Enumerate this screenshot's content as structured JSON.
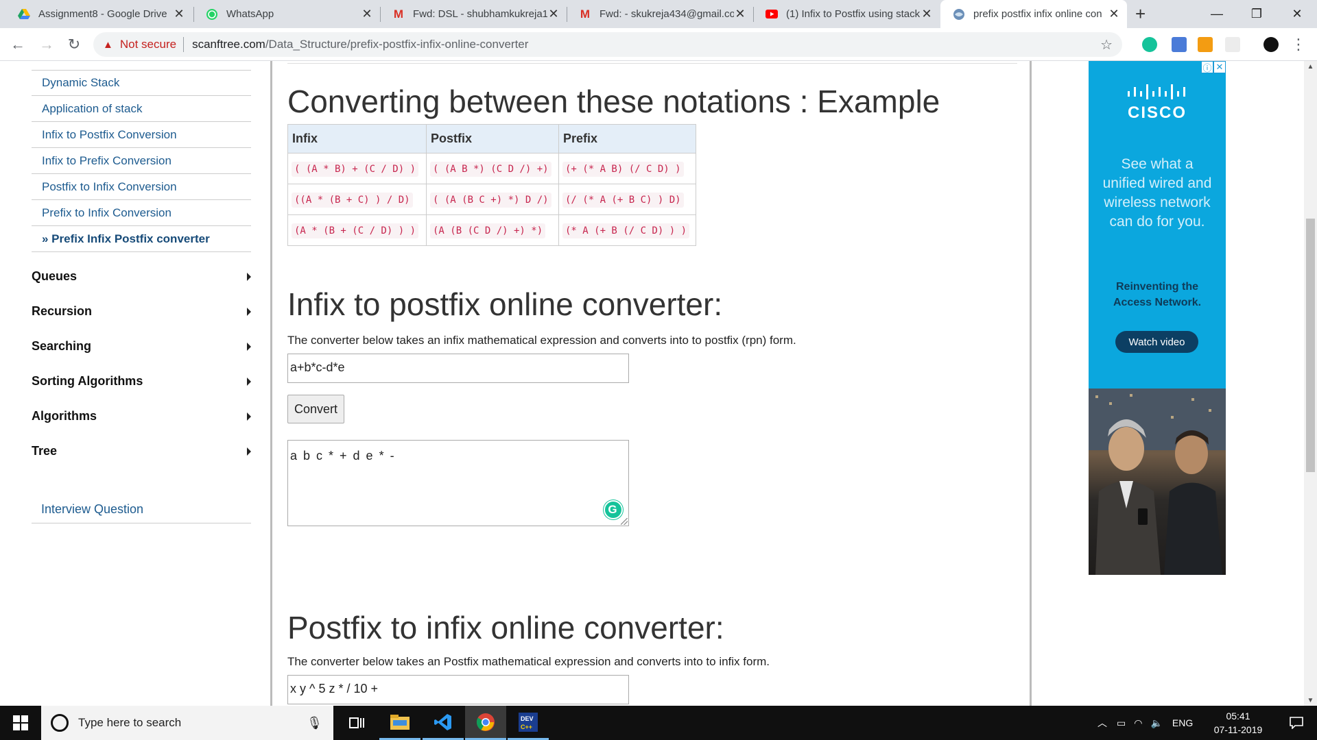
{
  "browser": {
    "tabs": [
      {
        "title": "Assignment8 - Google Drive",
        "icon": "google-drive-icon"
      },
      {
        "title": "WhatsApp",
        "icon": "whatsapp-icon"
      },
      {
        "title": "Fwd: DSL - shubhamkukreja1",
        "icon": "gmail-icon"
      },
      {
        "title": "Fwd: - skukreja434@gmail.co",
        "icon": "gmail-icon"
      },
      {
        "title": "(1) Infix to Postfix using stack",
        "icon": "youtube-icon"
      },
      {
        "title": "prefix postfix infix online con",
        "icon": "site-icon"
      }
    ],
    "security_label": "Not secure",
    "url_host": "scanftree.com",
    "url_path": "/Data_Structure/prefix-postfix-infix-online-converter"
  },
  "sidebar": {
    "sub_items": [
      "Dynamic Stack",
      "Application of stack",
      "Infix to Postfix Conversion",
      "Infix to Prefix Conversion",
      "Postfix to Infix Conversion",
      "Prefix to Infix Conversion",
      "» Prefix Infix Postfix converter"
    ],
    "menu_items": [
      "Queues",
      "Recursion",
      "Searching",
      "Sorting Algorithms",
      "Algorithms",
      "Tree"
    ],
    "interview_link": "Interview Question"
  },
  "main": {
    "example_heading": "Converting between these notations : Example",
    "table": {
      "headers": [
        "Infix",
        "Postfix",
        "Prefix"
      ],
      "rows": [
        [
          "( (A * B) + (C / D) )",
          "( (A B *) (C D /) +)",
          "(+ (* A B) (/ C D) )"
        ],
        [
          "((A * (B + C) ) / D)",
          "( (A (B C +) *) D /)",
          "(/ (* A (+ B C) ) D)"
        ],
        [
          "(A * (B + (C / D) ) )",
          "(A (B (C D /) +) *)",
          "(* A (+ B (/ C D) ) )"
        ]
      ]
    },
    "i2p": {
      "heading": "Infix to postfix online converter:",
      "description": "The converter below takes an infix mathematical expression and converts into to postfix (rpn) form.",
      "input_value": "a+b*c-d*e",
      "button_label": "Convert",
      "output_value": "a b c * + d e * -"
    },
    "p2i": {
      "heading": "Postfix to infix online converter:",
      "description": "The converter below takes an Postfix mathematical expression and converts into to infix form.",
      "input_value": "x y ^ 5 z * / 10 +"
    }
  },
  "ad": {
    "brand": "CISCO",
    "copy": [
      "See what a",
      "unified wired and",
      "wireless network",
      "can do for you."
    ],
    "tagline": [
      "Reinventing the",
      "Access Network."
    ],
    "button_label": "Watch video",
    "colors": {
      "background": "#0ba7de",
      "button": "#0c3f63"
    }
  },
  "taskbar": {
    "search_placeholder": "Type here to search",
    "language": "ENG",
    "time": "05:41",
    "date": "07-11-2019"
  },
  "colors": {
    "link": "#1d5b8f",
    "code_text": "#c7254e",
    "table_header_bg": "#e4eef8",
    "warning": "#c5221f"
  }
}
